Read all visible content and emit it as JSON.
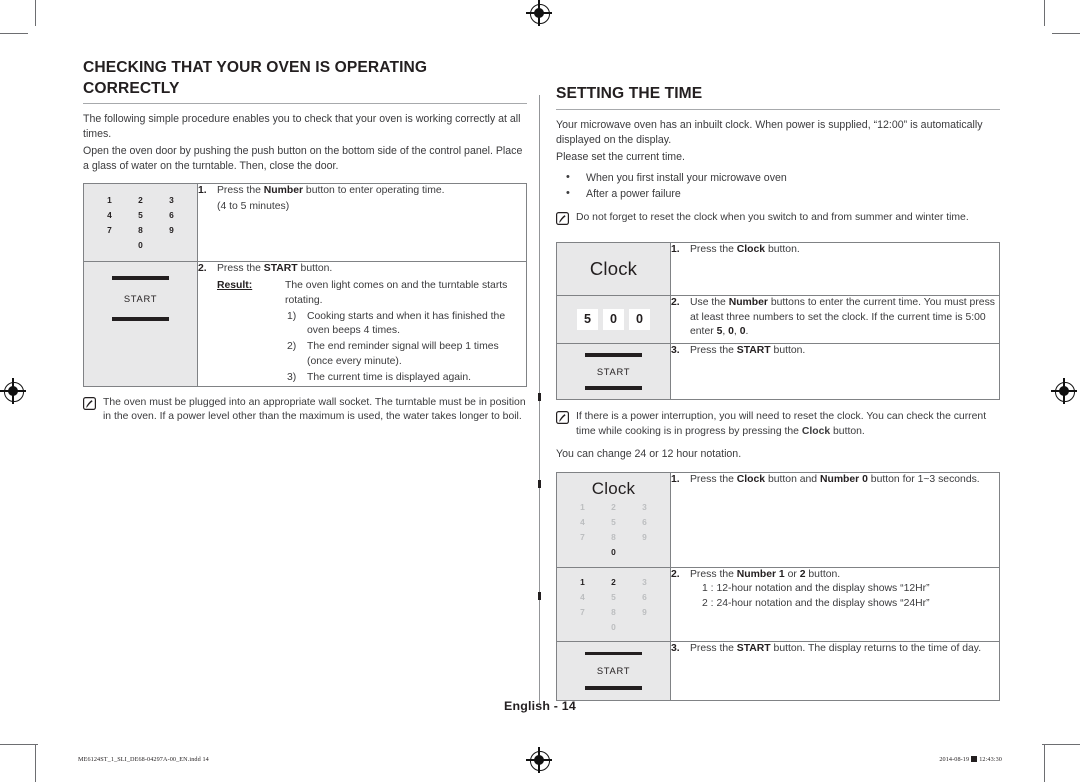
{
  "page": {
    "footer_page_label": "English - 14",
    "footer_left": "ME6124ST_1_SLI_DE68-04297A-00_EN.indd   14",
    "footer_right_date": "2014-08-19",
    "footer_right_time": "12:43:30"
  },
  "left_column": {
    "heading": "CHECKING THAT YOUR OVEN IS OPERATING CORRECTLY",
    "intro": [
      "The following simple procedure enables you to check that your oven is working correctly at all times.",
      "Open the oven door by pushing the push button on the bottom side of the control panel. Place a glass of water on the turntable. Then, close the door."
    ],
    "table": {
      "step1": {
        "num": "1.",
        "text_a": "Press the ",
        "bold_a": "Number",
        "text_b": " button to enter operating time.",
        "sub": "(4 to 5 minutes)",
        "keypad": {
          "row1": [
            "1",
            "2",
            "3"
          ],
          "row2": [
            "4",
            "5",
            "6"
          ],
          "row3": [
            "7",
            "8",
            "9"
          ],
          "row4": [
            "",
            "0",
            ""
          ]
        }
      },
      "step2": {
        "num": "2.",
        "text_a": "Press the ",
        "bold_a": "START",
        "text_b": " button.",
        "result_label": "Result:",
        "result_text": "The oven light comes on and the turntable starts rotating.",
        "result_items": [
          "Cooking starts and when it has finished the oven beeps 4 times.",
          "The end reminder signal will beep 1 times (once every minute).",
          "The current time is displayed again."
        ],
        "start_label": "START"
      }
    },
    "note": "The oven must be plugged into an appropriate wall socket. The turntable must be in position in the oven. If a power level other than the maximum is used, the water takes longer to boil."
  },
  "right_column": {
    "heading": "SETTING THE TIME",
    "intro": [
      "Your microwave oven has an inbuilt clock. When power is supplied, “12:00” is automatically displayed on the display.",
      "Please set the current time."
    ],
    "bullets": [
      "When you first install your microwave oven",
      "After a power failure"
    ],
    "note_top": "Do not forget to reset the clock when you switch to and from summer and winter time.",
    "table1": {
      "step1": {
        "num": "1.",
        "text_a": "Press the ",
        "bold_a": "Clock",
        "text_b": " button.",
        "clock_label": "Clock"
      },
      "step2": {
        "num": "2.",
        "text_a": "Use the ",
        "bold_a": "Number",
        "text_b": " buttons to enter the current time.",
        "line2_a": "You must press at least three numbers to set the clock. If the current time is 5:00 enter ",
        "line2_b1": "5",
        "line2_sep1": ", ",
        "line2_b2": "0",
        "line2_sep2": ", ",
        "line2_b3": "0",
        "line2_end": ".",
        "digits": [
          "5",
          "0",
          "0"
        ]
      },
      "step3": {
        "num": "3.",
        "text_a": "Press the ",
        "bold_a": "START",
        "text_b": " button.",
        "start_label": "START"
      }
    },
    "note_mid": "If there is a power interruption, you will need to reset the clock. You can check the current time while cooking is in progress by pressing the ",
    "note_mid_bold": "Clock",
    "note_mid_end": " button.",
    "paragraph_notation": "You can change 24 or 12 hour notation.",
    "table2": {
      "step1": {
        "num": "1.",
        "text_a": "Press the ",
        "bold_a": "Clock",
        "text_b": " button and ",
        "bold_b": "Number 0",
        "text_c": " button for 1~3 seconds.",
        "clock_label": "Clock",
        "keypad": {
          "row1": [
            "1",
            "2",
            "3"
          ],
          "row2": [
            "4",
            "5",
            "6"
          ],
          "row3": [
            "7",
            "8",
            "9"
          ],
          "row4": [
            "",
            "0",
            ""
          ],
          "highlight": "0"
        }
      },
      "step2": {
        "num": "2.",
        "text_a": "Press the ",
        "bold_a": "Number 1",
        "text_b": " or ",
        "bold_b": "2",
        "text_c": " button.",
        "line_a": "1 : 12-hour notation and the display shows “12Hr”",
        "line_b": "2 : 24-hour notation and the display shows “24Hr”",
        "keypad": {
          "row1": [
            "1",
            "2",
            "3"
          ],
          "row2": [
            "4",
            "5",
            "6"
          ],
          "row3": [
            "7",
            "8",
            "9"
          ],
          "row4": [
            "",
            "0",
            ""
          ],
          "highlight": "1,2"
        }
      },
      "step3": {
        "num": "3.",
        "text_a": "Press the ",
        "bold_a": "START",
        "text_b": " button. The display returns to the time of day.",
        "start_label": "START"
      }
    }
  },
  "colors": {
    "text": "#231f20",
    "body_text": "#3b3b3d",
    "rule": "#a7a9ac",
    "table_border": "#808285",
    "panel_bg": "#e8e8e9",
    "faint_key": "#bcbec0"
  }
}
